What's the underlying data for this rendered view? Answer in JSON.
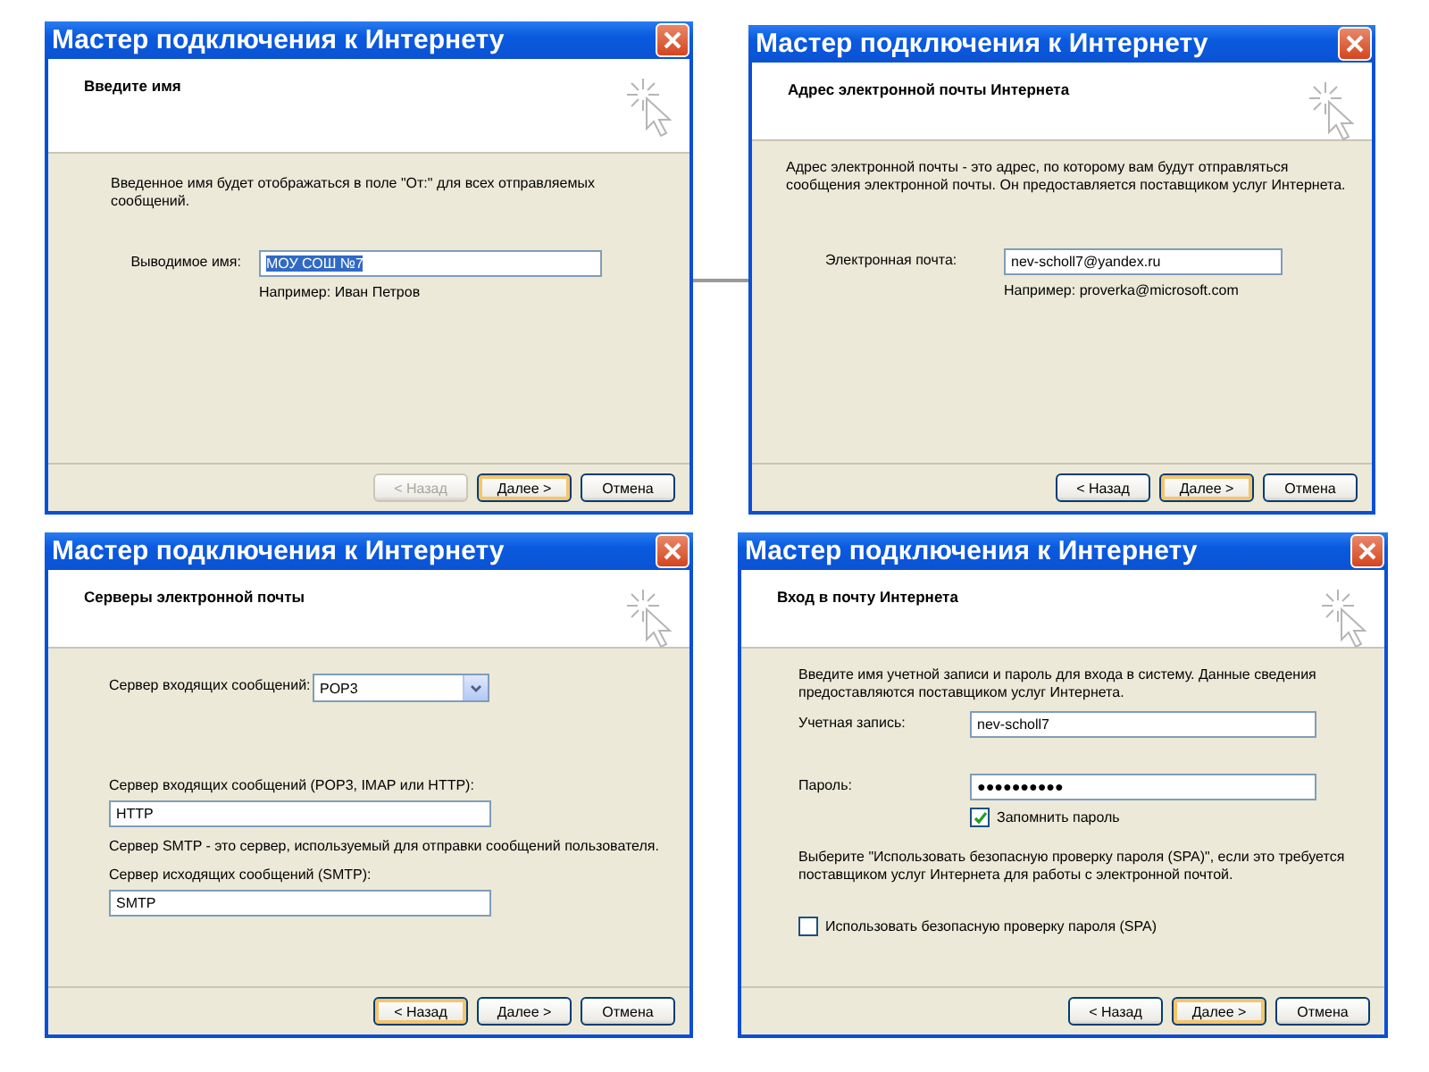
{
  "windows": [
    {
      "title": "Мастер подключения к Интернету",
      "heading": "Введите имя",
      "body": [
        {
          "kind": "text",
          "text": "Введенное имя будет отображаться в поле \"От:\" для всех отправляемых сообщений."
        },
        {
          "kind": "field",
          "label": "Выводимое имя:",
          "value": "МОУ СОШ №7",
          "text_selected": true,
          "hint": "Например: Иван Петров"
        }
      ],
      "buttons": [
        {
          "label": "< Назад",
          "disabled": true,
          "default": false
        },
        {
          "label": "Далее >",
          "disabled": false,
          "default": true
        },
        {
          "label": "Отмена",
          "disabled": false,
          "default": false
        }
      ]
    },
    {
      "title": "Мастер подключения к Интернету",
      "heading": "Адрес электронной почты Интернета",
      "body": [
        {
          "kind": "text",
          "text": "Адрес электронной почты - это адрес, по которому вам будут отправляться сообщения электронной почты. Он предоставляется поставщиком услуг Интернета."
        },
        {
          "kind": "field",
          "label": "Электронная почта:",
          "value": "nev-scholl7@yandex.ru",
          "text_selected": false,
          "hint": "Например: proverka@microsoft.com"
        }
      ],
      "buttons": [
        {
          "label": "< Назад",
          "disabled": false,
          "default": false
        },
        {
          "label": "Далее >",
          "disabled": false,
          "default": true
        },
        {
          "label": "Отмена",
          "disabled": false,
          "default": false
        }
      ]
    },
    {
      "title": "Мастер подключения к Интернету",
      "heading": "Серверы электронной почты",
      "body": [
        {
          "kind": "select",
          "label": "Сервер входящих сообщений:",
          "value": "POP3"
        },
        {
          "kind": "stacked",
          "label": "Сервер входящих сообщений (POP3, IMAP или HTTP):",
          "value": "HTTP"
        },
        {
          "kind": "text",
          "text": "Сервер SMTP - это сервер, используемый для отправки сообщений  пользователя."
        },
        {
          "kind": "stacked",
          "label": "Сервер исходящих сообщений (SMTP):",
          "value": "SMTP"
        }
      ],
      "buttons": [
        {
          "label": "< Назад",
          "disabled": false,
          "default": true
        },
        {
          "label": "Далее >",
          "disabled": false,
          "default": false
        },
        {
          "label": "Отмена",
          "disabled": false,
          "default": false
        }
      ]
    },
    {
      "title": "Мастер подключения к Интернету",
      "heading": "Вход в почту Интернета",
      "body": [
        {
          "kind": "text",
          "text": "Введите имя учетной записи и пароль для входа в систему. Данные сведения предоставляются поставщиком услуг Интернета."
        },
        {
          "kind": "field",
          "label": "Учетная запись:",
          "value": "nev-scholl7",
          "text_selected": false
        },
        {
          "kind": "password",
          "label": "Пароль:",
          "value": "●●●●●●●●●●",
          "option": {
            "label": "Запомнить пароль",
            "checked": true
          }
        },
        {
          "kind": "text",
          "text": "Выберите \"Использовать безопасную проверку пароля (SPA)\", если это требуется поставщиком услуг Интернета для работы с электронной почтой."
        },
        {
          "kind": "checkbox",
          "label": "Использовать безопасную проверку пароля (SPA)",
          "checked": false
        }
      ],
      "buttons": [
        {
          "label": "< Назад",
          "disabled": false,
          "default": false
        },
        {
          "label": "Далее >",
          "disabled": false,
          "default": true
        },
        {
          "label": "Отмена",
          "disabled": false,
          "default": false
        }
      ]
    }
  ]
}
